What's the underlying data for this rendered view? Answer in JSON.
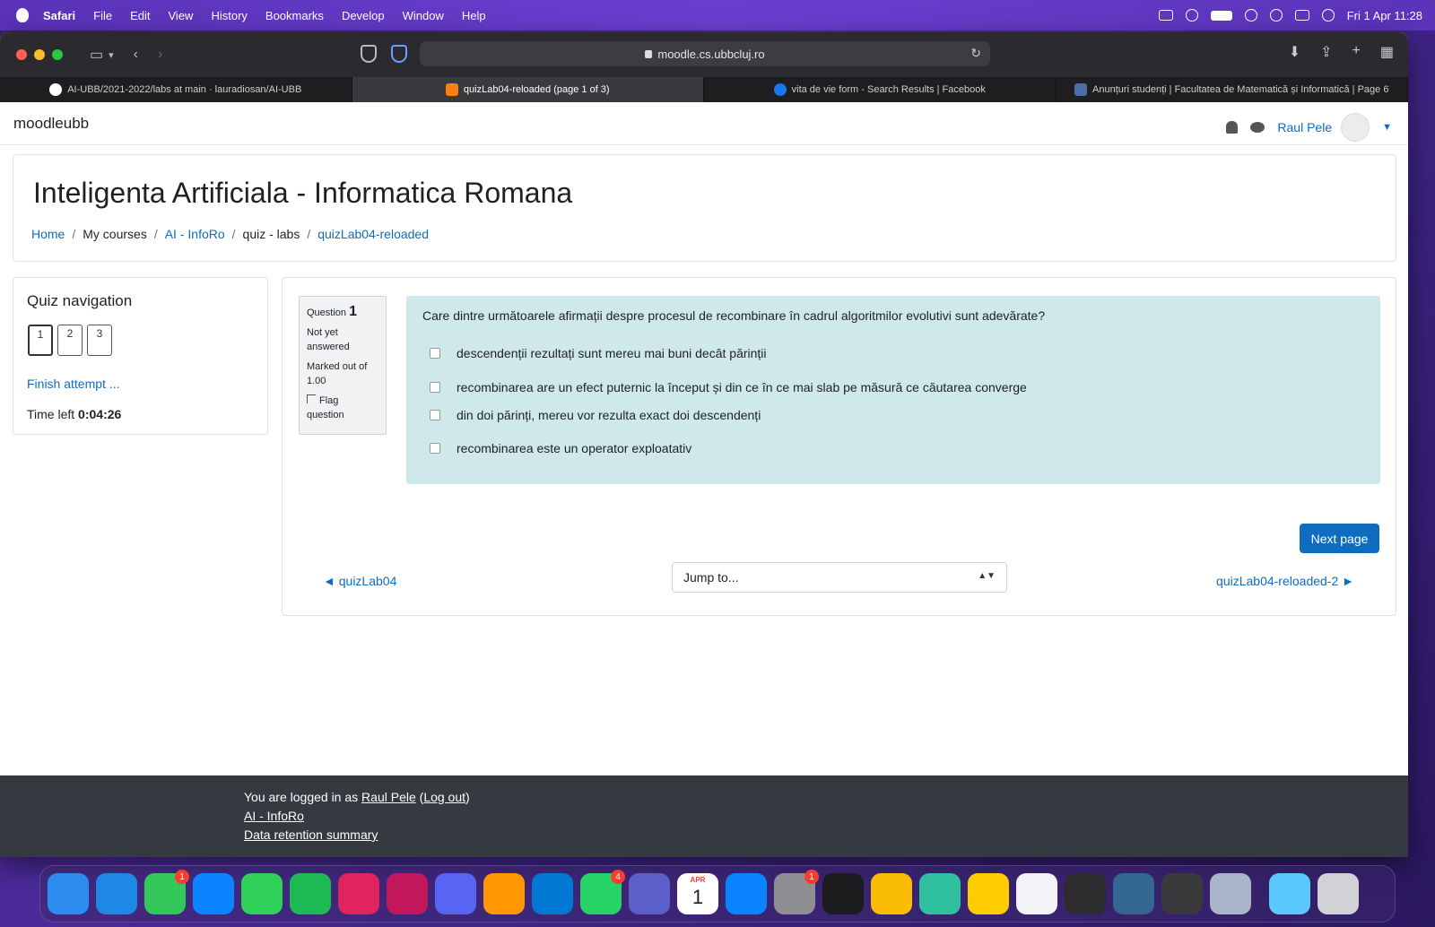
{
  "menubar": {
    "app": "Safari",
    "items": [
      "File",
      "Edit",
      "View",
      "History",
      "Bookmarks",
      "Develop",
      "Window",
      "Help"
    ],
    "clock": "Fri 1 Apr  11:28"
  },
  "browser": {
    "address": "moodle.cs.ubbcluj.ro",
    "tabs": [
      {
        "label": "AI-UBB/2021-2022/labs at main · lauradiosan/AI-UBB",
        "favicon": "#ffffff",
        "active": false
      },
      {
        "label": "quizLab04-reloaded (page 1 of 3)",
        "favicon": "#f98012",
        "active": true
      },
      {
        "label": "vita de vie form - Search Results | Facebook",
        "favicon": "#1877f2",
        "active": false
      },
      {
        "label": "Anunțuri studenți | Facultatea de Matematică și Informatică | Page 6",
        "favicon": "#4a6fa5",
        "active": false
      }
    ]
  },
  "navbar": {
    "brand": "moodleubb",
    "user": "Raul Pele"
  },
  "header": {
    "title": "Inteligenta Artificiala - Informatica Romana",
    "breadcrumb": {
      "home": "Home",
      "my_courses": "My courses",
      "course": "AI - InfoRo",
      "section": "quiz - labs",
      "quiz": "quizLab04-reloaded"
    }
  },
  "quiz_nav": {
    "heading": "Quiz navigation",
    "pages": [
      "1",
      "2",
      "3"
    ],
    "finish": "Finish attempt ...",
    "time_label": "Time left",
    "time_value": "0:04:26"
  },
  "question": {
    "label": "Question",
    "number": "1",
    "status": "Not yet answered",
    "marked": "Marked out of 1.00",
    "flag": "Flag question",
    "text": "Care dintre următoarele afirmații despre procesul de recombinare în cadrul algoritmilor evolutivi sunt adevărate?",
    "options": [
      "descendenții rezultați sunt mereu mai buni decât părinții",
      "recombinarea are un efect puternic la început și din ce în ce mai slab pe măsură ce căutarea converge",
      "din doi părinți, mereu vor rezulta exact doi descendenți",
      "recombinarea este un operator exploatativ"
    ]
  },
  "navigation": {
    "next_page": "Next page",
    "prev_link": "◄ quizLab04",
    "jump_placeholder": "Jump to...",
    "next_link": "quizLab04-reloaded-2 ►"
  },
  "footer": {
    "logged_in_prefix": "You are logged in as",
    "user": "Raul Pele",
    "logout": "Log out",
    "course": "AI - InfoRo",
    "retention": "Data retention summary"
  },
  "dock": {
    "apps": [
      {
        "name": "finder",
        "color": "#2d8cf0"
      },
      {
        "name": "safari",
        "color": "#1e88e5"
      },
      {
        "name": "messages",
        "color": "#34c759",
        "badge": "1"
      },
      {
        "name": "testflight",
        "color": "#0a84ff"
      },
      {
        "name": "facetime",
        "color": "#30d158"
      },
      {
        "name": "spotify",
        "color": "#1db954"
      },
      {
        "name": "intellij",
        "color": "#e0245e"
      },
      {
        "name": "rider",
        "color": "#c2185b"
      },
      {
        "name": "discord",
        "color": "#5865f2"
      },
      {
        "name": "sublime",
        "color": "#ff9800"
      },
      {
        "name": "vscode",
        "color": "#0078d4"
      },
      {
        "name": "whatsapp",
        "color": "#25d366",
        "badge": "4"
      },
      {
        "name": "teams",
        "color": "#5b5fc7"
      },
      {
        "name": "calendar",
        "color": "#ffffff",
        "month": "APR",
        "day": "1"
      },
      {
        "name": "app-store",
        "color": "#0a84ff"
      },
      {
        "name": "system-preferences",
        "color": "#8e8e93",
        "badge": "1"
      },
      {
        "name": "terminal-alt",
        "color": "#1c1c1e"
      },
      {
        "name": "chrome",
        "color": "#fbbc05"
      },
      {
        "name": "xcode-remote",
        "color": "#30c0a0"
      },
      {
        "name": "reeder",
        "color": "#ffcc00"
      },
      {
        "name": "reminders",
        "color": "#f2f2f7"
      },
      {
        "name": "terminal",
        "color": "#2c2c2e"
      },
      {
        "name": "postgres",
        "color": "#336791"
      },
      {
        "name": "quicktime",
        "color": "#3a3a3c"
      },
      {
        "name": "preview",
        "color": "#aab4c8"
      },
      {
        "name": "downloads-folder",
        "color": "#5ac8fa"
      },
      {
        "name": "trash",
        "color": "#d1d1d6"
      }
    ]
  }
}
